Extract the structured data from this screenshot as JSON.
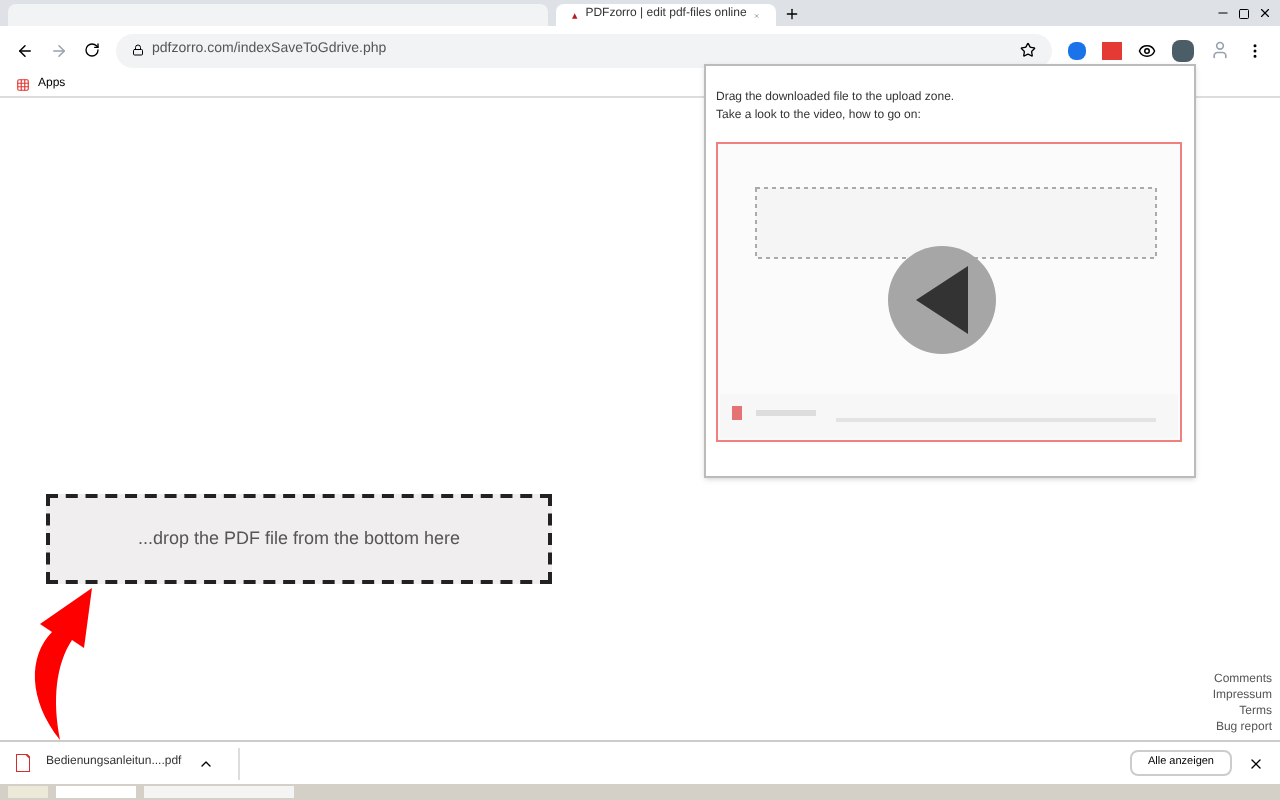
{
  "tabs": [
    {
      "selected": false
    },
    {
      "label": "PDFzorro | edit pdf-files online",
      "selected": true
    }
  ],
  "address": {
    "url": "pdfzorro.com/indexSaveToGdrive.php"
  },
  "bookmarks": [
    {
      "label": "Apps"
    }
  ],
  "popup": {
    "lines": [
      "Drag the downloaded file to the upload zone.",
      "Take a look to the video, how to go on:"
    ]
  },
  "dropzone": {
    "label": "...drop the PDF file from the bottom here"
  },
  "footer_links": [
    "Comments",
    "Impressum",
    "Terms",
    "Bug report"
  ],
  "downloads": {
    "file": "Bedienungsanleitun....pdf",
    "show_all": "Alle anzeigen"
  }
}
